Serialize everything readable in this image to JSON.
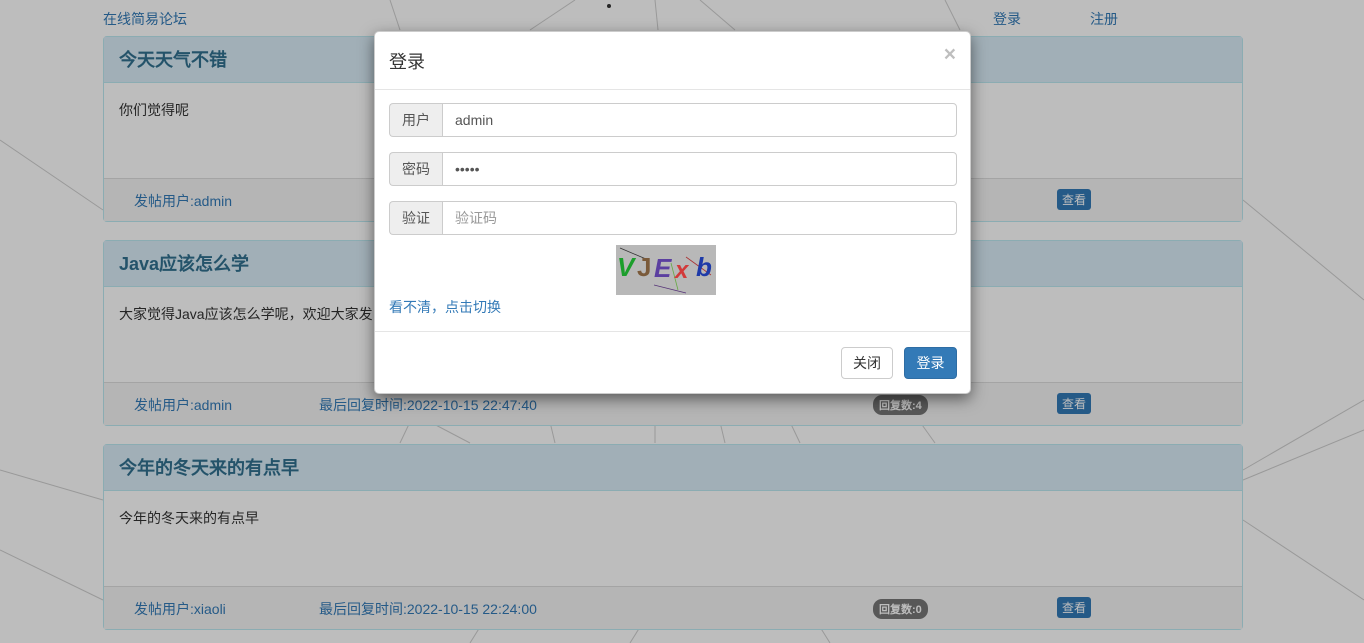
{
  "nav": {
    "brand": "在线简易论坛",
    "login": "登录",
    "register": "注册"
  },
  "posts": [
    {
      "title": "今天天气不错",
      "body": "你们觉得呢",
      "user": "发帖用户:admin",
      "last_reply": "",
      "reply_count": "",
      "view": "查看"
    },
    {
      "title": "Java应该怎么学",
      "body": "大家觉得Java应该怎么学呢，欢迎大家发",
      "user": "发帖用户:admin",
      "last_reply": "最后回复时间:2022-10-15 22:47:40",
      "reply_count": "回复数:4",
      "view": "查看"
    },
    {
      "title": "今年的冬天来的有点早",
      "body": "今年的冬天来的有点早",
      "user": "发帖用户:xiaoli",
      "last_reply": "最后回复时间:2022-10-15 22:24:00",
      "reply_count": "回复数:0",
      "view": "查看"
    }
  ],
  "modal": {
    "title": "登录",
    "close_symbol": "×",
    "user_label": "用户",
    "user_value": "admin",
    "password_label": "密码",
    "password_value": "admin",
    "captcha_label": "验证",
    "captcha_placeholder": "验证码",
    "captcha_text": "VJExb",
    "refresh_link": "看不清，点击切换",
    "close_button": "关闭",
    "login_button": "登录"
  },
  "colors": {
    "link": "#337ab7",
    "panel_heading": "#d9edf7",
    "primary": "#337ab7"
  }
}
